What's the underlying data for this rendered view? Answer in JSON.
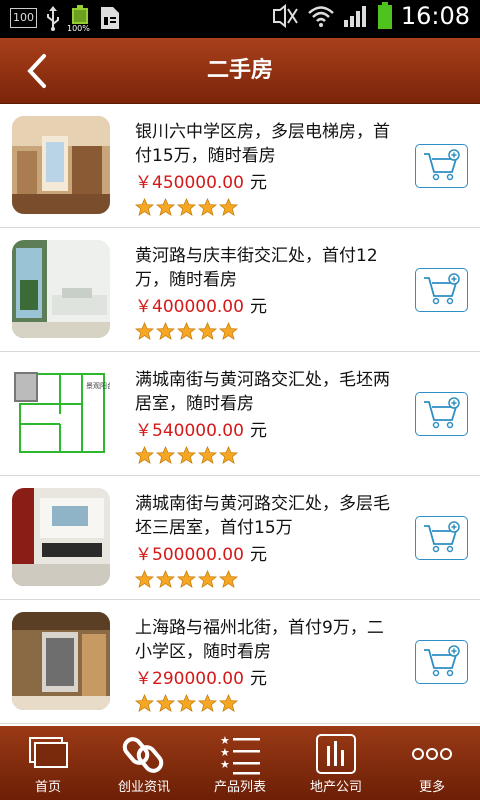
{
  "status_bar": {
    "badge": "100",
    "battery_pct": "100%",
    "time": "16:08"
  },
  "header": {
    "title": "二手房"
  },
  "listings": [
    {
      "title": "银川六中学区房，多层电梯房，首付15万，随时看房",
      "price": "￥450000.00",
      "unit": "元",
      "rating": 5
    },
    {
      "title": "黄河路与庆丰街交汇处，首付12万，随时看房",
      "price": "￥400000.00",
      "unit": "元",
      "rating": 5
    },
    {
      "title": "满城南街与黄河路交汇处，毛坯两居室，随时看房",
      "price": "￥540000.00",
      "unit": "元",
      "rating": 5
    },
    {
      "title": "满城南街与黄河路交汇处，多层毛坯三居室，首付15万",
      "price": "￥500000.00",
      "unit": "元",
      "rating": 5
    },
    {
      "title": "上海路与福州北街，首付9万，二小学区，随时看房",
      "price": "￥290000.00",
      "unit": "元",
      "rating": 5
    }
  ],
  "floorplan_label": "景观阳台",
  "bottom_nav": [
    {
      "label": "首页",
      "icon": "home-icon"
    },
    {
      "label": "创业资讯",
      "icon": "link-icon"
    },
    {
      "label": "产品列表",
      "icon": "list-icon"
    },
    {
      "label": "地产公司",
      "icon": "chart-icon"
    },
    {
      "label": "更多",
      "icon": "more-icon"
    }
  ],
  "colors": {
    "header": "#8e3211",
    "price": "#d51919",
    "star": "#f5a623",
    "cart": "#2f8fc4"
  }
}
